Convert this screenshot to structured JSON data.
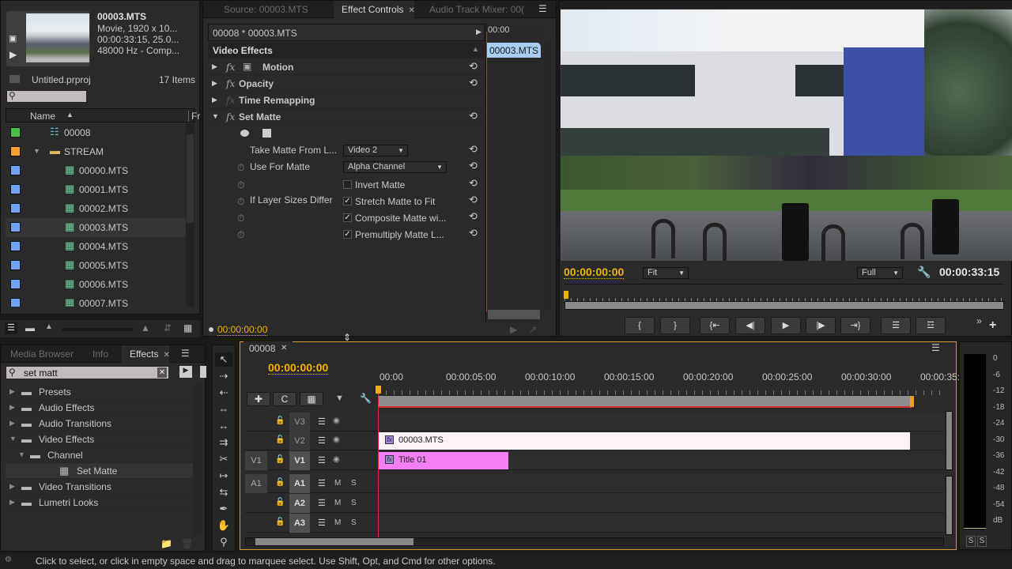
{
  "project": {
    "clip_name": "00003.MTS",
    "clip_info": [
      "Movie, 1920 x 10...",
      "00:00:33:15, 25.0...",
      "48000 Hz - Comp..."
    ],
    "project_name": "Untitled.prproj",
    "item_count": "17 Items",
    "search_placeholder": "",
    "columns": {
      "name": "Name",
      "frame": "Fr"
    },
    "items": [
      {
        "label": "00008",
        "color": "#44c24a",
        "type": "sequence"
      },
      {
        "label": "STREAM",
        "color": "#f5a030",
        "type": "folder"
      },
      {
        "label": "00000.MTS",
        "color": "#6fa4f5",
        "type": "clip"
      },
      {
        "label": "00001.MTS",
        "color": "#6fa4f5",
        "type": "clip"
      },
      {
        "label": "00002.MTS",
        "color": "#6fa4f5",
        "type": "clip"
      },
      {
        "label": "00003.MTS",
        "color": "#6fa4f5",
        "type": "clip",
        "selected": true
      },
      {
        "label": "00004.MTS",
        "color": "#6fa4f5",
        "type": "clip"
      },
      {
        "label": "00005.MTS",
        "color": "#6fa4f5",
        "type": "clip"
      },
      {
        "label": "00006.MTS",
        "color": "#6fa4f5",
        "type": "clip"
      },
      {
        "label": "00007.MTS",
        "color": "#6fa4f5",
        "type": "clip"
      }
    ]
  },
  "effect_controls": {
    "tabs": [
      "Source: 00003.MTS",
      "Effect Controls",
      "Audio Track Mixer: 00("
    ],
    "active_tab": "Effect Controls",
    "clip_path": "00008 * 00003.MTS",
    "mini_timecode": "00:00",
    "mini_clip": "00003.MTS",
    "section": "Video Effects",
    "effects": [
      "Motion",
      "Opacity",
      "Time Remapping",
      "Set Matte"
    ],
    "params": {
      "take_matte_label": "Take Matte From L...",
      "take_matte_value": "Video 2",
      "use_for_matte_label": "Use For Matte",
      "use_for_matte_value": "Alpha Channel",
      "invert_matte": "Invert Matte",
      "if_layer_sizes_label": "If Layer Sizes Differ",
      "stretch_matte": "Stretch Matte to Fit",
      "composite_matte": "Composite Matte wi...",
      "premultiply_matte": "Premultiply Matte L..."
    },
    "checks": {
      "invert": false,
      "stretch": true,
      "composite": true,
      "premultiply": true
    },
    "timecode": "00:00:00:00"
  },
  "program": {
    "timecode": "00:00:00:00",
    "zoom": "Fit",
    "quality": "Full",
    "duration": "00:00:33:15"
  },
  "effects_panel": {
    "tabs": [
      "Media Browser",
      "Info",
      "Effects"
    ],
    "active_tab": "Effects",
    "search_value": "set matt",
    "tree": [
      {
        "label": "Presets",
        "level": 0,
        "open": false
      },
      {
        "label": "Audio Effects",
        "level": 0,
        "open": false
      },
      {
        "label": "Audio Transitions",
        "level": 0,
        "open": false
      },
      {
        "label": "Video Effects",
        "level": 0,
        "open": true
      },
      {
        "label": "Channel",
        "level": 1,
        "open": true
      },
      {
        "label": "Set Matte",
        "level": 2,
        "leaf": true
      },
      {
        "label": "Video Transitions",
        "level": 0,
        "open": false
      },
      {
        "label": "Lumetri Looks",
        "level": 0,
        "open": false
      }
    ]
  },
  "timeline": {
    "tab": "00008",
    "timecode": "00:00:00:00",
    "ruler": [
      "00:00",
      "00:00:05:00",
      "00:00:10:00",
      "00:00:15:00",
      "00:00:20:00",
      "00:00:25:00",
      "00:00:30:00",
      "00:00:35:"
    ],
    "video_tracks": [
      {
        "src": "",
        "name": "V3"
      },
      {
        "src": "",
        "name": "V2"
      },
      {
        "src": "V1",
        "name": "V1"
      }
    ],
    "audio_tracks": [
      {
        "src": "A1",
        "name": "A1"
      },
      {
        "src": "",
        "name": "A2"
      },
      {
        "src": "",
        "name": "A3"
      }
    ],
    "mute": "M",
    "solo": "S",
    "clips": [
      {
        "label": "00003.MTS",
        "track": "V2",
        "start_sec": 0,
        "end_sec": 33.6
      },
      {
        "label": "Title 01",
        "track": "V1",
        "start_sec": 0,
        "end_sec": 8.2
      }
    ]
  },
  "meter": {
    "scale": [
      "0",
      "-6",
      "-12",
      "-18",
      "-24",
      "-30",
      "-36",
      "-42",
      "-48",
      "-54",
      "dB"
    ],
    "solo": [
      "S",
      "S"
    ]
  },
  "status_bar": {
    "text": "Click to select, or click in empty space and drag to marquee select. Use Shift, Opt, and Cmd for other options."
  }
}
